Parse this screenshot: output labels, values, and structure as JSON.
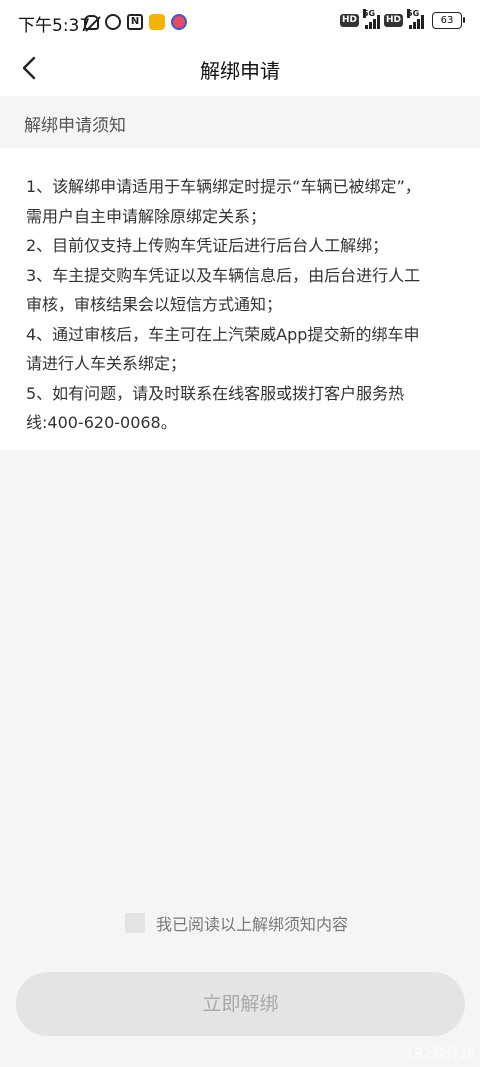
{
  "status_bar": {
    "time": "下午5:37",
    "network_1": "5G",
    "network_2": "5G",
    "hd_label": "HD",
    "battery": "63"
  },
  "nav": {
    "title": "解绑申请"
  },
  "notice": {
    "header": "解绑申请须知",
    "lines": [
      "1、该解绑申请适用于车辆绑定时提示“车辆已被绑定”，",
      "需用户自主申请解除原绑定关系；",
      "2、目前仅支持上传购车凭证后进行后台人工解绑；",
      "3、车主提交购车凭证以及车辆信息后，由后台进行人工",
      "审核，审核结果会以短信方式通知；",
      "4、通过审核后，车主可在上汽荣威App提交新的绑车申",
      "请进行人车关系绑定；",
      "5、如有问题，请及时联系在线客服或拨打客户服务热",
      "线:400-620-0068。"
    ]
  },
  "agreement": {
    "label": "我已阅读以上解绑须知内容",
    "checked": false
  },
  "submit": {
    "label": "立即解绑",
    "enabled": false
  },
  "watermark": "192软件站"
}
